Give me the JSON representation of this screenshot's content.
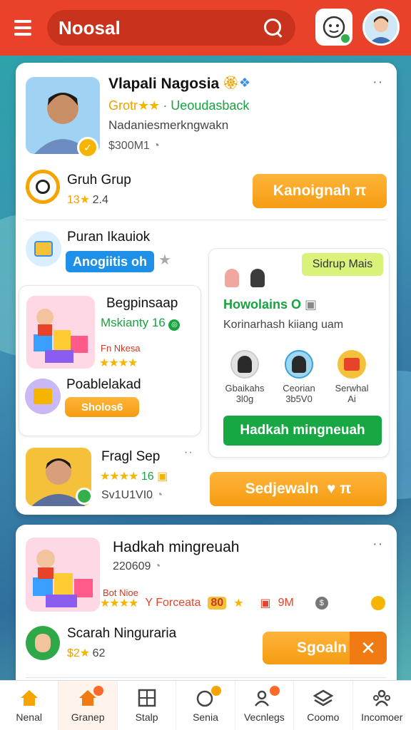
{
  "header": {
    "brand": "Noosal",
    "icons": [
      "menu-icon",
      "search-icon",
      "face-icon",
      "avatar-icon"
    ]
  },
  "profile": {
    "name": "Vlapali Nagosia",
    "tagline_a": "Grotr",
    "tagline_b": "· Ueoudasback",
    "description": "Nadaniesmerkngwakn",
    "meta": "$300M1"
  },
  "group": {
    "title": "Gruh Grup",
    "rating": "13",
    "rating_suffix": "2.4",
    "button": "Kanoignah"
  },
  "purchase": {
    "title": "Puran Ikauiok",
    "chip": "Anogiitis oh"
  },
  "begin_card": {
    "title": "Begpinsaap",
    "subtitle": "Mskianty",
    "count": "16",
    "tag": "Fn Nkesa"
  },
  "possible": {
    "title": "Poablelakad",
    "chip": "Sholos6"
  },
  "right_panel": {
    "badge": "Sidrup Mais",
    "title": "Howolains O",
    "desc": "Korinarhash kiiang uam",
    "people": [
      {
        "name": "Gbaikahs",
        "sub": "3l0g"
      },
      {
        "name": "Ceorian",
        "sub": "3b5V0"
      },
      {
        "name": "Serwhal",
        "sub": "Ai"
      }
    ],
    "button": "Hadkah mingneuah"
  },
  "fragl": {
    "title": "Fragl Sep",
    "count": "16",
    "meta": "Sv1U1VI0",
    "button": "Sedjewaln"
  },
  "second": {
    "title": "Hadkah mingreuah",
    "meta": "220609",
    "tag": "Bot Nioe",
    "forecast": "Y Forceata",
    "score": "80",
    "size": "9M",
    "user_name": "Scarah Ninguraria",
    "user_rating": "$2",
    "user_count": "62",
    "button": "Sgoaln"
  },
  "nav": [
    {
      "label": "Nenal",
      "icon": "home-icon"
    },
    {
      "label": "Granep",
      "icon": "home-badge-icon"
    },
    {
      "label": "Stalp",
      "icon": "grid-icon"
    },
    {
      "label": "Senia",
      "icon": "chat-icon"
    },
    {
      "label": "Vecnlegs",
      "icon": "people-icon"
    },
    {
      "label": "Coomo",
      "icon": "layers-icon"
    },
    {
      "label": "Incomoer",
      "icon": "team-icon"
    }
  ]
}
